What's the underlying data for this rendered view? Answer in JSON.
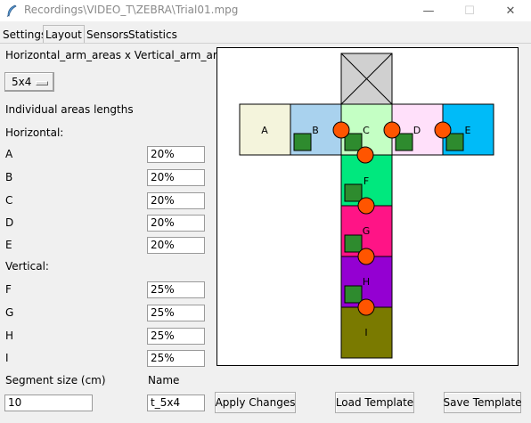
{
  "window": {
    "title": "Recordings\\VIDEO_T\\ZEBRA\\Trial01.mpg",
    "minimize_glyph": "—",
    "maximize_glyph": "☐",
    "close_glyph": "✕"
  },
  "tabs": [
    "Settings",
    "Layout",
    "Sensors",
    "Statistics"
  ],
  "active_tab": "Layout",
  "form": {
    "arm_areas_label": "Horizontal_arm_areas x Vertical_arm_areas",
    "arm_areas_value": "5x4",
    "individual_lengths_label": "Individual areas lengths",
    "horizontal_label": "Horizontal:",
    "vertical_label": "Vertical:",
    "horizontal_areas": [
      {
        "name": "A",
        "value": "20%"
      },
      {
        "name": "B",
        "value": "20%"
      },
      {
        "name": "C",
        "value": "20%"
      },
      {
        "name": "D",
        "value": "20%"
      },
      {
        "name": "E",
        "value": "20%"
      }
    ],
    "vertical_areas": [
      {
        "name": "F",
        "value": "25%"
      },
      {
        "name": "G",
        "value": "25%"
      },
      {
        "name": "H",
        "value": "25%"
      },
      {
        "name": "I",
        "value": "25%"
      }
    ],
    "segment_size_label": "Segment size (cm)",
    "segment_size_value": "10",
    "name_label": "Name",
    "name_value": "t_5x4"
  },
  "buttons": {
    "apply": "Apply Changes",
    "load": "Load Template",
    "save": "Save Template"
  },
  "maze": {
    "colors": {
      "A": "#f4f4dc",
      "B": "#a9d2ee",
      "C": "#c4ffc4",
      "D": "#ffe0fa",
      "E": "#00bbf8",
      "F": "#00e87e",
      "G": "#ff1486",
      "H": "#9400d2",
      "I": "#7a7a00",
      "top": "#d0d0d0",
      "sensor_square": "#2e8b2e",
      "sensor_circle": "#ff5500"
    },
    "labels": [
      "A",
      "B",
      "C",
      "D",
      "E",
      "F",
      "G",
      "H",
      "I"
    ]
  }
}
